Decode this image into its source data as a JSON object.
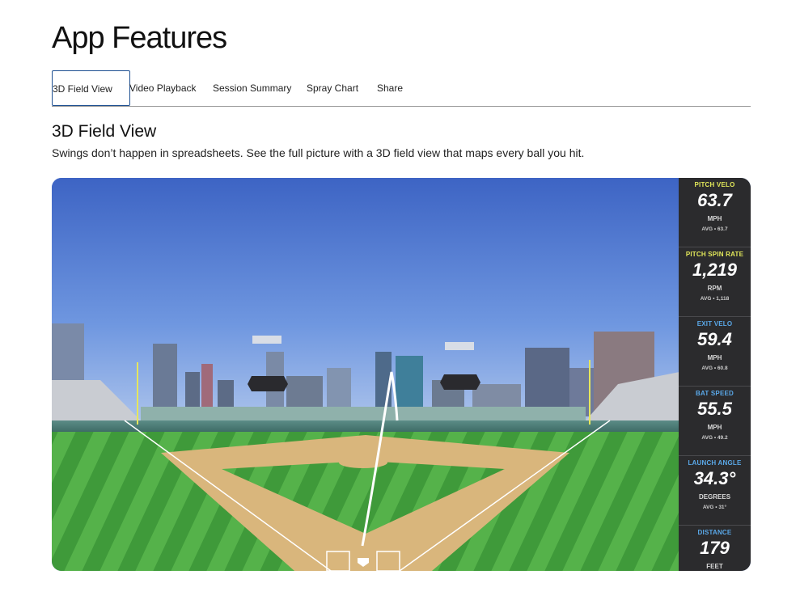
{
  "page": {
    "title": "App Features"
  },
  "tabs": [
    {
      "label": "3D Field View",
      "active": true
    },
    {
      "label": "Video Playback",
      "active": false
    },
    {
      "label": "Session Summary",
      "active": false
    },
    {
      "label": "Spray Chart",
      "active": false
    },
    {
      "label": "Share",
      "active": false
    }
  ],
  "section": {
    "heading": "3D Field View",
    "description": "Swings don’t happen in spreadsheets. See the full picture with a 3D field view that maps every ball you hit."
  },
  "stats": [
    {
      "label": "PITCH VELO",
      "value": "63.7",
      "unit": "MPH",
      "avg": "AVG • 63.7",
      "label_color": "#e2e85a"
    },
    {
      "label": "PITCH SPIN RATE",
      "value": "1,219",
      "unit": "RPM",
      "avg": "AVG • 1,118",
      "label_color": "#e2e85a"
    },
    {
      "label": "EXIT VELO",
      "value": "59.4",
      "unit": "MPH",
      "avg": "AVG • 60.8",
      "label_color": "#5aa8e8"
    },
    {
      "label": "BAT SPEED",
      "value": "55.5",
      "unit": "MPH",
      "avg": "AVG • 49.2",
      "label_color": "#5aa8e8"
    },
    {
      "label": "LAUNCH ANGLE",
      "value": "34.3°",
      "unit": "DEGREES",
      "avg": "AVG • 31°",
      "label_color": "#5aa8e8"
    },
    {
      "label": "DISTANCE",
      "value": "179",
      "unit": "FEET",
      "avg": "",
      "label_color": "#5aa8e8"
    }
  ]
}
